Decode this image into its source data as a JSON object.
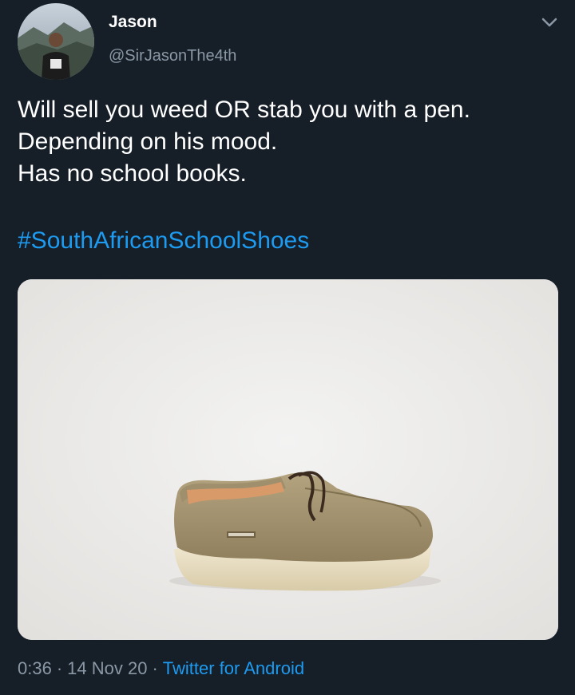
{
  "user": {
    "display_name": "Jason",
    "handle": "@SirJasonThe4th",
    "avatar_icon": "profile-photo"
  },
  "tweet": {
    "lines": [
      "Will sell you weed OR stab you with a pen.",
      "Depending on his mood.",
      "Has no school books."
    ],
    "hashtag": "#SouthAfricanSchoolShoes"
  },
  "media": {
    "subject": "shoe-photo"
  },
  "meta": {
    "time": "0:36",
    "separator": "·",
    "date": "14 Nov 20",
    "source": "Twitter for Android"
  },
  "colors": {
    "background": "#161e28",
    "text": "#ffffff",
    "secondary_text": "#8a98a6",
    "link": "#1d9bf0"
  }
}
